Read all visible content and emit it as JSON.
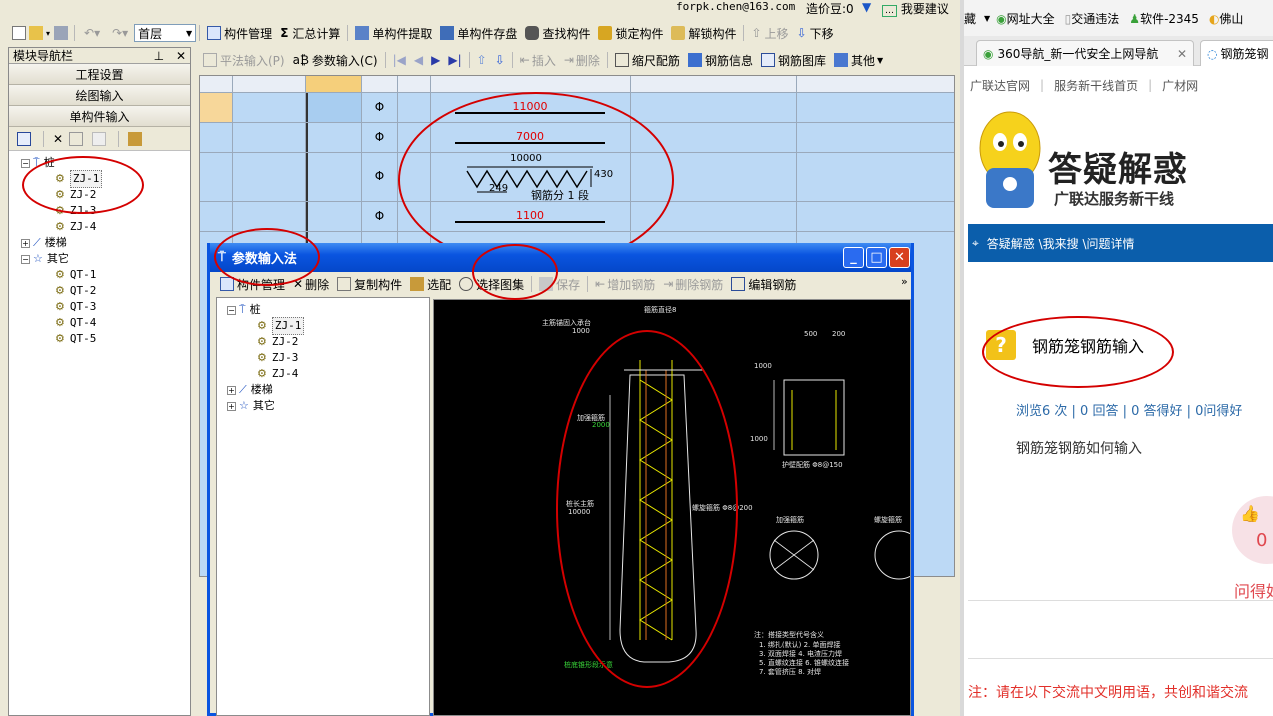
{
  "app": {
    "userbar": {
      "account": "forpk.chen@163.com",
      "bean_label": "造价豆:0",
      "suggest": "我要建议"
    },
    "toolbar1": {
      "floor": "首层",
      "items": [
        "构件管理",
        "汇总计算",
        "单构件提取",
        "单构件存盘",
        "查找构件",
        "锁定构件",
        "解锁构件",
        "上移",
        "下移"
      ]
    },
    "toolbar2": {
      "items": [
        "平法输入(P)",
        "参数输入(C)",
        "插入",
        "删除",
        "缩尺配筋",
        "钢筋信息",
        "钢筋图库",
        "其他"
      ]
    },
    "nav": {
      "title": "模块导航栏",
      "buttons": [
        "工程设置",
        "绘图输入",
        "单构件输入"
      ],
      "tree": {
        "pile": "桩",
        "pile_items": [
          "ZJ-1",
          "ZJ-2",
          "ZJ-3",
          "ZJ-4"
        ],
        "stair": "楼梯",
        "other": "其它",
        "other_items": [
          "QT-1",
          "QT-2",
          "QT-3",
          "QT-4",
          "QT-5"
        ]
      }
    },
    "grid": {
      "rows": [
        {
          "symbol": "Φ",
          "value": "11000"
        },
        {
          "symbol": "Φ",
          "value": "7000"
        },
        {
          "symbol": "Φ",
          "top": "10000",
          "side": "430",
          "left": "249",
          "note": "钢筋分 1 段"
        },
        {
          "symbol": "Φ",
          "value": "1100"
        }
      ]
    },
    "dialog": {
      "title": "参数输入法",
      "toolbar": [
        "构件管理",
        "删除",
        "复制构件",
        "选配",
        "选择图集",
        "保存",
        "增加钢筋",
        "删除钢筋",
        "编辑钢筋"
      ],
      "tree": {
        "pile": "桩",
        "pile_items": [
          "ZJ-1",
          "ZJ-2",
          "ZJ-3",
          "ZJ-4"
        ],
        "stair": "楼梯",
        "other": "其它"
      },
      "cad": {
        "top_note": "箍筋直径8",
        "left_top_label": "主筋锚固入承台",
        "left_top_value": "1000",
        "mid_left_label": "加强箍筋",
        "mid_left_value": "2000",
        "long_label": "桩长主筋",
        "long_value": "10000",
        "right_note1": "螺旋箍筋 Φ8@200",
        "right_note2": "护壁配筋 Φ8@150",
        "dims": [
          "500",
          "200",
          "1000",
          "1000"
        ],
        "section1": "加强箍筋",
        "section2": "螺旋箍筋",
        "bottom_note": "注：搭接类型代号含义",
        "bottom_lines": [
          "1. 绑扎(默认)  2. 单面焊接",
          "3. 双面焊接  4. 电渣压力焊",
          "5. 直螺纹连接  6. 锥螺纹连接",
          "7. 套管挤压  8. 对焊"
        ],
        "footer": "桩底锥形段示意"
      }
    }
  },
  "browser": {
    "favbar": [
      "藏",
      "网址大全",
      "交通违法",
      "软件-2345",
      "佛山"
    ],
    "tabs": [
      "360导航_新一代安全上网导航",
      "钢筋笼钢"
    ],
    "links": [
      "广联达官网",
      "服务新干线首页",
      "广材网"
    ],
    "banner": {
      "title": "答疑解惑",
      "subtitle": "广联达服务新干线"
    },
    "breadcrumb": "答疑解惑 \\我来搜 \\问题详情",
    "question": {
      "title": "钢筋笼钢筋输入",
      "stats": "浏览6 次 | 0 回答 | 0 答得好 | 0问得好",
      "body": "钢筋笼钢筋如何输入",
      "likes": "0",
      "ask_good": "问得好"
    },
    "notice": "注：请在以下交流中文明用语，共创和谐交流"
  }
}
